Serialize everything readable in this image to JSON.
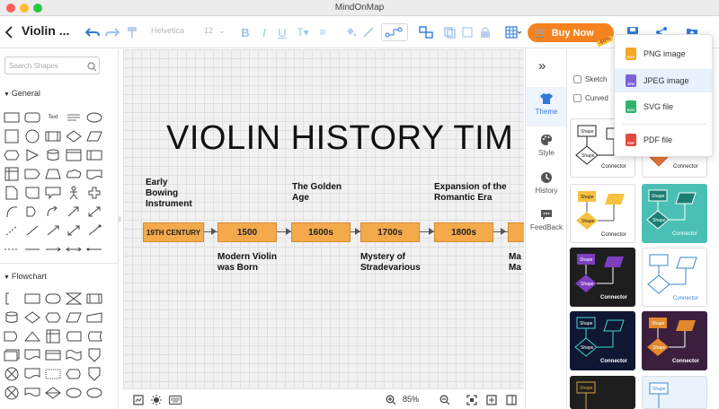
{
  "window": {
    "title": "MindOnMap"
  },
  "toolbar": {
    "doc_title": "Violin ...",
    "font_family": "Helvetica",
    "font_size": "12",
    "buy_now_label": "Buy Now",
    "discount_badge": "-60%"
  },
  "left_panel": {
    "search_placeholder": "Search Shapes",
    "sections": [
      {
        "title": "General"
      },
      {
        "title": "Flowchart"
      }
    ],
    "general_text_shape": "Text"
  },
  "canvas": {
    "heading": "VIOLIN HISTORY TIM",
    "timeline_boxes": [
      "19TH CENTURY",
      "1500",
      "1600s",
      "1700s",
      "1800s"
    ],
    "labels_above": [
      "Early\nBowing\nInstrument",
      "The Golden\nAge",
      "Expansion of the\nRomantic Era"
    ],
    "labels_below": [
      "Modern Violin\nwas Born",
      "Mystery of\nStradevarious",
      "Ma\nMa"
    ]
  },
  "status_bar": {
    "zoom": "85%"
  },
  "side_tabs": [
    {
      "label": "Theme",
      "active": true
    },
    {
      "label": "Style",
      "active": false
    },
    {
      "label": "History",
      "active": false
    },
    {
      "label": "FeedBack",
      "active": false
    }
  ],
  "theme_panel": {
    "options": [
      "Sketch",
      "Curved"
    ],
    "card_shape_label": "Shape",
    "card_connector_label": "Connector"
  },
  "export_menu": {
    "items": [
      {
        "label": "PNG image",
        "icon": "png-file-icon",
        "color": "#f5a623"
      },
      {
        "label": "JPEG image",
        "icon": "jpeg-file-icon",
        "color": "#7b61d9"
      },
      {
        "label": "SVG file",
        "icon": "svg-file-icon",
        "color": "#2fb36b"
      },
      {
        "label": "PDF file",
        "icon": "pdf-file-icon",
        "color": "#e5483f"
      }
    ],
    "highlighted": "JPEG image"
  },
  "colors": {
    "accent": "#2f7bd8",
    "buy_button": "#f5821f",
    "timeline_box": "#f4a94b"
  }
}
